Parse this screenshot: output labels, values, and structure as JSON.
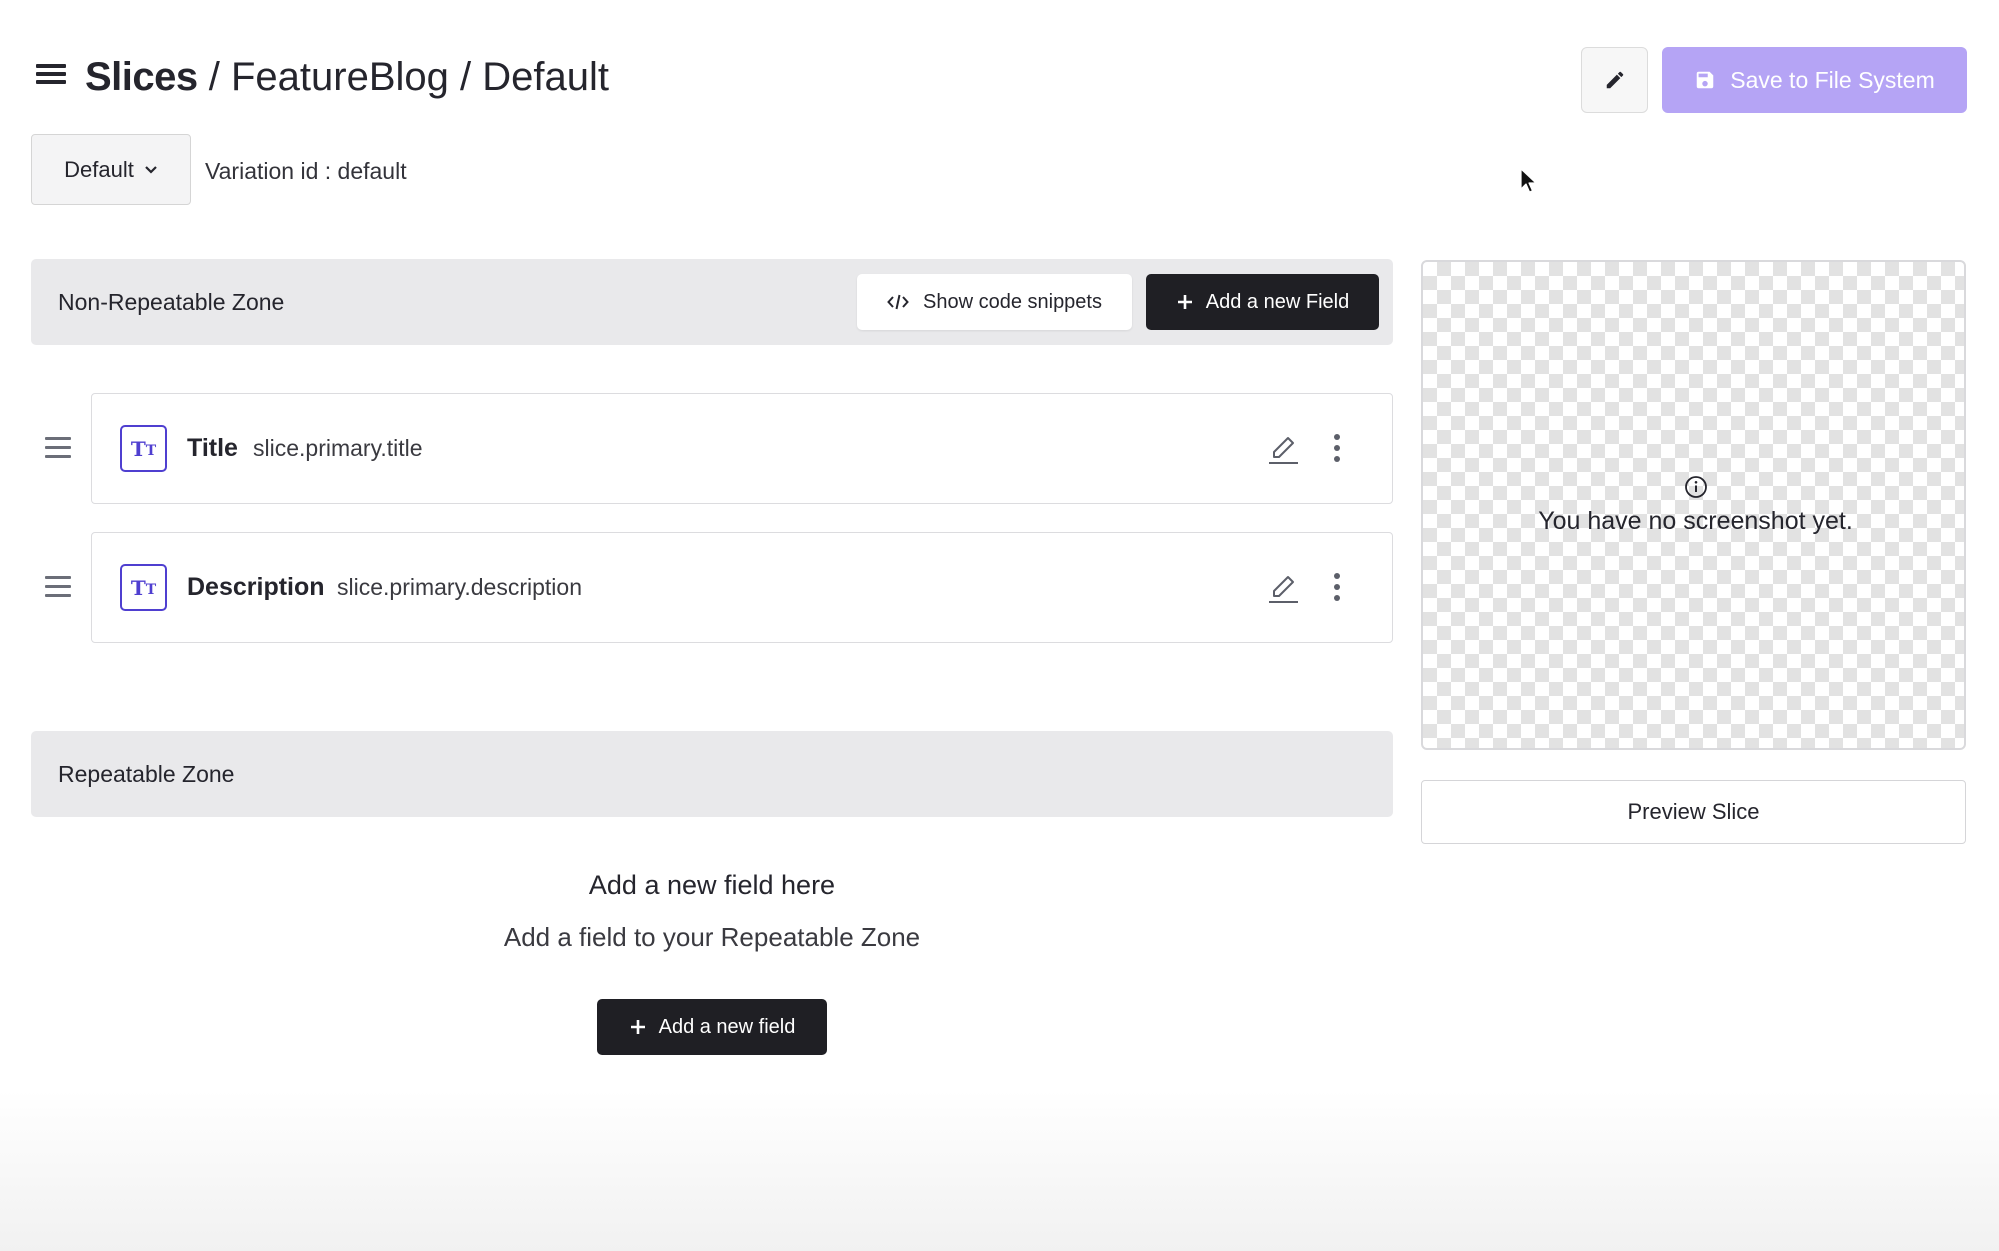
{
  "header": {
    "breadcrumb_root": "Slices",
    "breadcrumb_rest": " / FeatureBlog / Default",
    "save_label": "Save to File System"
  },
  "variation": {
    "selected": "Default",
    "id_text": "Variation id : default"
  },
  "non_repeatable": {
    "title": "Non-Repeatable Zone",
    "snippets_label": "Show code snippets",
    "add_field_label": "Add a new Field",
    "fields": [
      {
        "name": "Title",
        "key": "slice.primary.title",
        "type_icon": "text-type-icon"
      },
      {
        "name": "Description",
        "key": "slice.primary.description",
        "type_icon": "text-type-icon"
      }
    ]
  },
  "repeatable": {
    "title": "Repeatable Zone",
    "empty_heading": "Add a new field here",
    "empty_sub": "Add a field to your Repeatable Zone",
    "add_field_label": "Add a new field"
  },
  "screenshot": {
    "message": "You have no screenshot yet.",
    "preview_label": "Preview Slice"
  },
  "colors": {
    "save_button": "#b5a4f5",
    "dark_button": "#1f1f24",
    "field_icon": "#4f3fd0",
    "zone_header": "#e9e9eb"
  }
}
